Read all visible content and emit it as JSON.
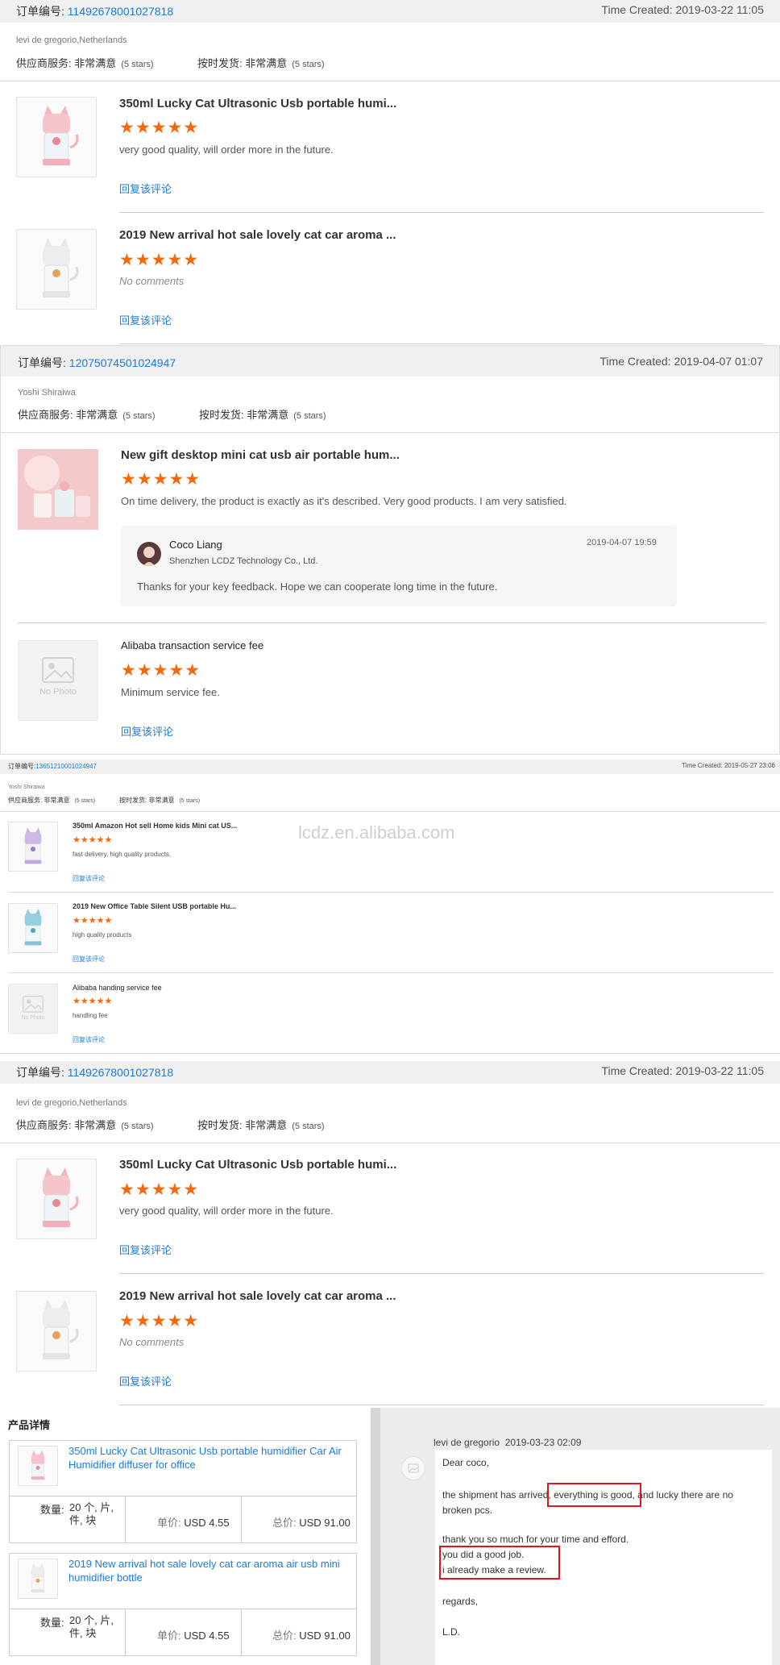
{
  "order1": {
    "order_label": "订单编号:",
    "order_no": "11492678001027818",
    "time_created": "Time Created: 2019-03-22 11:05",
    "buyer": "levi de gregorio,Netherlands",
    "supplier_service_label": "供应商服务: 非常满意",
    "supplier_service_stars": "(5 stars)",
    "on_time_label": "按时发货: 非常满意",
    "on_time_stars": "(5 stars)",
    "items": [
      {
        "title": "350ml Lucky Cat Ultrasonic Usb portable humi...",
        "stars": "★★★★★",
        "comment": "very good quality, will order more in the future.",
        "reply": "回复该评论"
      },
      {
        "title": "2019 New arrival hot sale lovely cat car aroma ...",
        "stars": "★★★★★",
        "comment": "No comments",
        "reply": "回复该评论"
      }
    ]
  },
  "order2": {
    "order_label": "订单编号:",
    "order_no": "12075074501024947",
    "time_created": "Time Created: 2019-04-07 01:07",
    "buyer": "Yoshi Shiraiwa",
    "supplier_service_label": "供应商服务: 非常满意",
    "supplier_service_stars": "(5 stars)",
    "on_time_label": "按时发货: 非常满意",
    "on_time_stars": "(5 stars)",
    "items": [
      {
        "title": "New gift desktop mini cat usb air portable hum...",
        "stars": "★★★★★",
        "comment": "On time delivery, the product is exactly as it's described. Very good products. I am very satisfied."
      },
      {
        "title": "Alibaba transaction service fee",
        "stars": "★★★★★",
        "comment": "Minimum service fee.",
        "reply": "回复该评论",
        "no_photo": "No Photo"
      }
    ],
    "seller_reply": {
      "name": "Coco Liang",
      "company": "Shenzhen LCDZ Technology Co., Ltd.",
      "date": "2019-04-07 19:59",
      "text": "Thanks for your key feedback. Hope we can cooperate long time in the future."
    }
  },
  "order3": {
    "order_label": "订单编号:",
    "order_no": "13651210001024947",
    "time_created": "Time Created: 2019-05-27 23:06",
    "buyer": "Yoshi Shiraiwa",
    "supplier_service_label": "供应商服务: 非常满意",
    "supplier_service_stars": "(5 stars)",
    "on_time_label": "按时发货: 非常满意",
    "on_time_stars": "(5 stars)",
    "watermark": "lcdz.en.alibaba.com",
    "items": [
      {
        "title": "350ml Amazon Hot sell Home kids Mini cat US...",
        "stars": "★★★★★",
        "comment": "fast delivery, high quality products,",
        "reply": "回复该评论"
      },
      {
        "title": "2019 New Office Table Silent USB portable Hu...",
        "stars": "★★★★★",
        "comment": "high quality products",
        "reply": "回复该评论"
      },
      {
        "title": "Alibaba handing service fee",
        "stars": "★★★★★",
        "comment": "handling fee",
        "reply": "回复该评论",
        "no_photo": "No Photo"
      }
    ]
  },
  "order4": {
    "order_label": "订单编号:",
    "order_no": "11492678001027818",
    "time_created": "Time Created: 2019-03-22 11:05",
    "buyer": "levi de gregorio,Netherlands",
    "supplier_service_label": "供应商服务: 非常满意",
    "supplier_service_stars": "(5 stars)",
    "on_time_label": "按时发货: 非常满意",
    "on_time_stars": "(5 stars)",
    "items": [
      {
        "title": "350ml Lucky Cat Ultrasonic Usb portable humi...",
        "stars": "★★★★★",
        "comment": "very good quality, will order more in the future.",
        "reply": "回复该评论"
      },
      {
        "title": "2019 New arrival hot sale lovely cat car aroma ...",
        "stars": "★★★★★",
        "comment": "No comments",
        "reply": "回复该评论"
      }
    ]
  },
  "product_details": {
    "heading": "产品详情",
    "items": [
      {
        "title": "350ml Lucky Cat Ultrasonic Usb portable humidifier Car Air Humidifier diffuser for office",
        "qty_label": "数量:",
        "qty": "20 个, 片, 件, 块",
        "unit_label": "单价:",
        "unit": "USD 4.55",
        "total_label": "总价:",
        "total": "USD 91.00"
      },
      {
        "title": "2019 New arrival hot sale lovely cat car aroma air usb mini humidifier bottle",
        "qty_label": "数量:",
        "qty": "20 个, 片, 件, 块",
        "unit_label": "单价:",
        "unit": "USD 4.55",
        "total_label": "总价:",
        "total": "USD 91.00"
      }
    ]
  },
  "message": {
    "sender": "levi de gregorio",
    "date": "2019-03-23 02:09",
    "greeting": "Dear coco,",
    "line1a": "the shipment has arrived,",
    "line1b": "everything is good,",
    "line1c": "and lucky there are no broken pcs.",
    "line2": "thank you so much for your time and efford.",
    "line3": "you did a good job.",
    "line4": "i already make a review.",
    "regards": "regards,",
    "sign": "L.D."
  },
  "colors": {
    "accent_link": "#1a7bd6",
    "star": "#f26a10",
    "highlight_box": "#e0161f"
  }
}
